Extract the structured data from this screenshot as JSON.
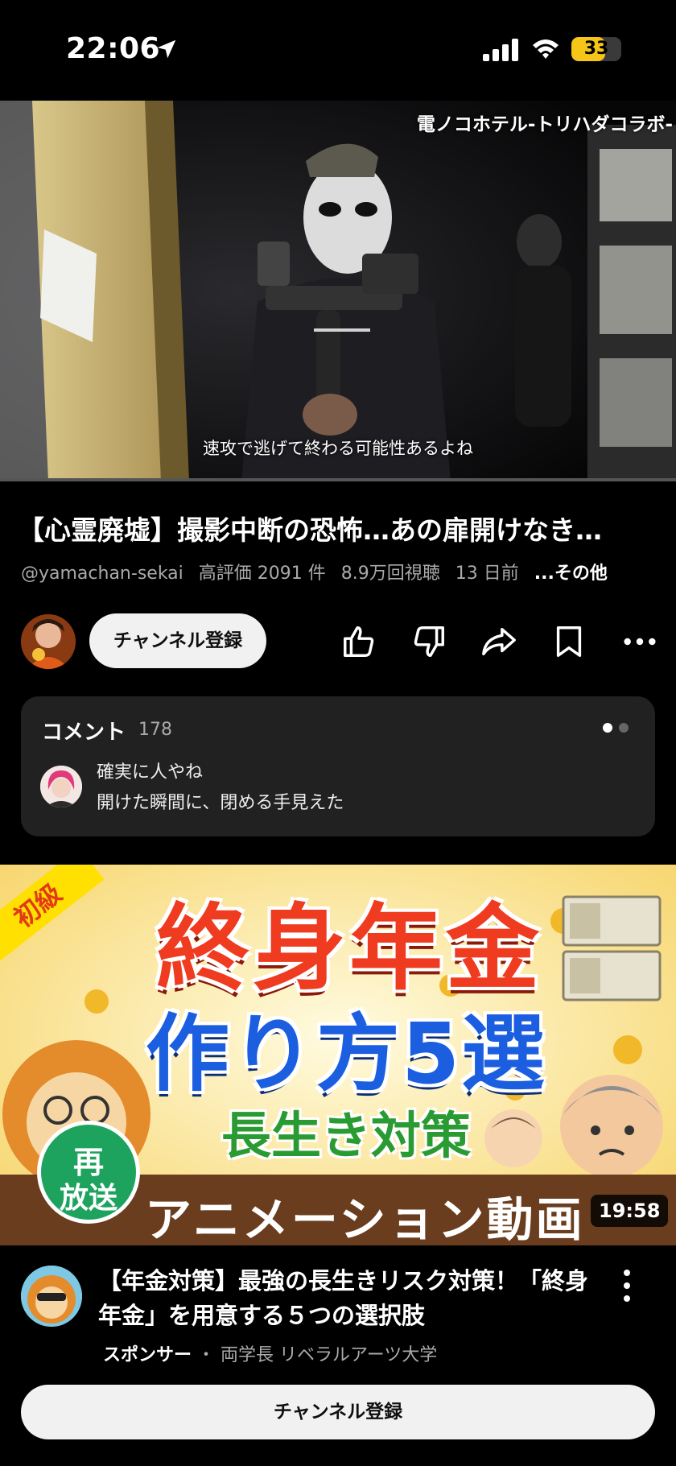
{
  "status_bar": {
    "time": "22:06",
    "battery_level": "33",
    "battery_fraction": 0.33,
    "icons": [
      "location-arrow-icon",
      "cellular-signal-icon",
      "wifi-icon",
      "battery-icon"
    ],
    "battery_color": "#f5c518"
  },
  "video": {
    "watermark": "電ノコホテル-トリハダコラボ-",
    "subtitle": "速攻で逃げて終わる可能性あるよね"
  },
  "video_info": {
    "title": "【心霊廃墟】撮影中断の恐怖…あの扉開けなき…",
    "channel_handle": "@yamachan-sekai",
    "likes": "高評価 2091 件",
    "views": "8.9万回視聴",
    "age": "13 日前",
    "more": "...その他"
  },
  "actions": {
    "subscribe_label": "チャンネル登録",
    "icons": [
      "thumbs-up-icon",
      "thumbs-down-icon",
      "share-icon",
      "save-icon",
      "more-icon"
    ]
  },
  "comments": {
    "label": "コメント",
    "count": "178",
    "line1": "確実に人やね",
    "line2": "開けた瞬間に、閉める手見えた"
  },
  "ad": {
    "thumb": {
      "corner_badge": "初級",
      "title1": "終身年金",
      "title2": "作り方5選",
      "title3": "長生き対策",
      "band": "アニメーション動画",
      "rerun_1": "再",
      "rerun_2": "放送",
      "duration": "19:58"
    },
    "title": "【年金対策】最強の長生きリスク対策！「終身年金」を用意する５つの選択肢",
    "sponsor": "スポンサー",
    "separator": "・",
    "channel": "両学長 リベラルアーツ大学",
    "subscribe_label": "チャンネル登録"
  },
  "colors": {
    "background": "#000000",
    "card": "#212121",
    "pill": "#f1f1f1",
    "secondary_text": "#aaaaaa"
  }
}
